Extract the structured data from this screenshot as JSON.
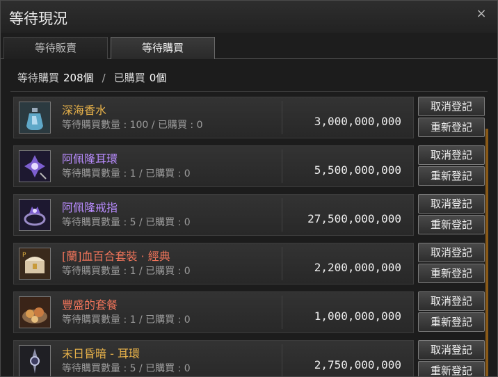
{
  "window": {
    "title": "等待現況",
    "close": "×"
  },
  "tabs": [
    {
      "label": "等待販賣",
      "active": false
    },
    {
      "label": "等待購買",
      "active": true
    }
  ],
  "summary": {
    "pending_label": "等待購買",
    "pending_count": "208個",
    "separator": "/",
    "bought_label": "已購買",
    "bought_count": "0個"
  },
  "buttons": {
    "cancel": "取消登記",
    "reregister": "重新登記"
  },
  "items": [
    {
      "name": "深海香水",
      "name_color": "#e8b24a",
      "qty": "等待購買數量 : 100 / 已購買 : 0",
      "price": "3,000,000,000",
      "icon": "perfume-bottle-icon"
    },
    {
      "name": "阿佩隆耳環",
      "name_color": "#b98cff",
      "qty": "等待購買數量 : 1 / 已購買 : 0",
      "price": "5,500,000,000",
      "icon": "earring-icon"
    },
    {
      "name": "阿佩隆戒指",
      "name_color": "#b98cff",
      "qty": "等待購買數量 : 5 / 已購買 : 0",
      "price": "27,500,000,000",
      "icon": "ring-icon"
    },
    {
      "name": "[蘭]血百合套裝 · 經典",
      "name_color": "#f0745a",
      "qty": "等待購買數量 : 1 / 已購買 : 0",
      "price": "2,200,000,000",
      "icon": "treasure-chest-icon"
    },
    {
      "name": "豐盛的套餐",
      "name_color": "#f0745a",
      "qty": "等待購買數量 : 1 / 已購買 : 0",
      "price": "1,000,000,000",
      "icon": "meal-platter-icon"
    },
    {
      "name": "末日昏暗 - 耳環",
      "name_color": "#e8b24a",
      "qty": "等待購買數量 : 5 / 已購買 : 0",
      "price": "2,750,000,000",
      "icon": "dark-earring-icon"
    }
  ]
}
